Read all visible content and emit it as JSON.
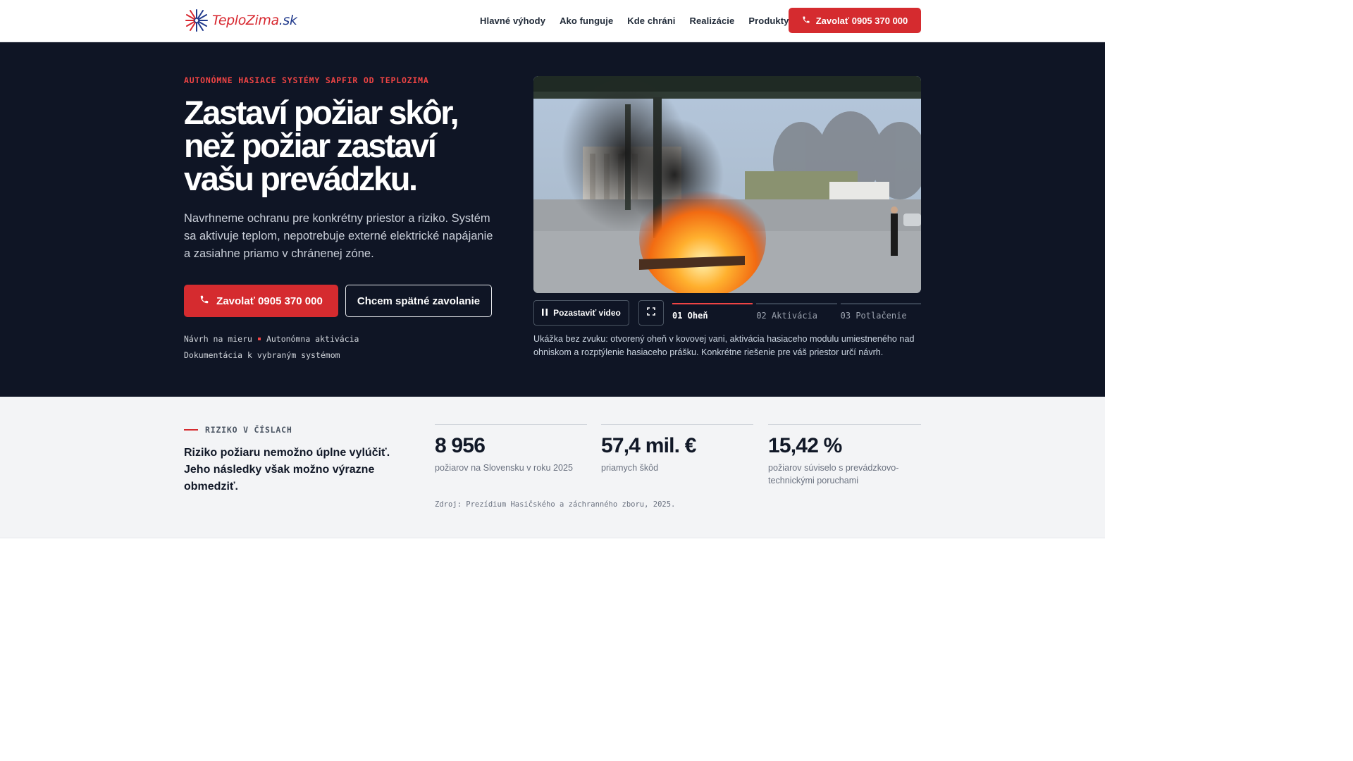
{
  "brand": {
    "name_part1": "TeploZima",
    "name_part2": ".sk"
  },
  "nav": [
    {
      "label": "Hlavné výhody"
    },
    {
      "label": "Ako funguje"
    },
    {
      "label": "Kde chráni"
    },
    {
      "label": "Realizácie"
    },
    {
      "label": "Produkty"
    }
  ],
  "header_cta": {
    "label": "Zavolať 0905 370 000",
    "icon": "phone-icon"
  },
  "hero": {
    "eyebrow": "AUTONÓMNE HASIACE SYSTÉMY SAPFIR OD TEPLOZIMA",
    "title": "Zastaví požiar skôr, než požiar zastaví vašu prevádzku.",
    "lead": "Navrhneme ochranu pre konkrétny priestor a riziko. Systém sa aktivuje teplom, nepotrebuje externé elektrické napájanie a zasiahne priamo v chránenej zóne.",
    "primary_button": "Zavolať 0905 370 000",
    "secondary_button": "Chcem spätné zavolanie",
    "features_line1_a": "Návrh na mieru",
    "features_line1_b": "Autonómna aktivácia",
    "features_line2": "Dokumentácia k vybraným systémom"
  },
  "video": {
    "pause_label": "Pozastaviť video",
    "steps": [
      {
        "label": "01 Oheň",
        "active": true
      },
      {
        "label": "02 Aktivácia",
        "active": false
      },
      {
        "label": "03 Potlačenie",
        "active": false
      }
    ],
    "caption": "Ukážka bez zvuku: otvorený oheň v kovovej vani, aktivácia hasiaceho modulu umiestneného nad ohniskom a rozptýlenie hasiaceho prášku. Konkrétne riešenie pre váš priestor určí návrh."
  },
  "stats": {
    "label": "RIZIKO V ČÍSLACH",
    "intro": "Riziko požiaru nemožno úplne vylúčiť. Jeho následky však možno výrazne obmedziť.",
    "items": [
      {
        "value": "8 956",
        "desc": "požiarov na Slovensku v roku 2025"
      },
      {
        "value": "57,4 mil. €",
        "desc": "priamych škôd"
      },
      {
        "value": "15,42 %",
        "desc": "požiarov súviselo s prevádzkovo-technickými poruchami"
      }
    ],
    "source": "Zdroj: Prezídium Hasičského a záchranného zboru, 2025."
  },
  "colors": {
    "accent": "#d52b2f",
    "hero_bg": "#0f1525",
    "stats_bg": "#f3f4f6",
    "brand_blue": "#213a8c"
  }
}
